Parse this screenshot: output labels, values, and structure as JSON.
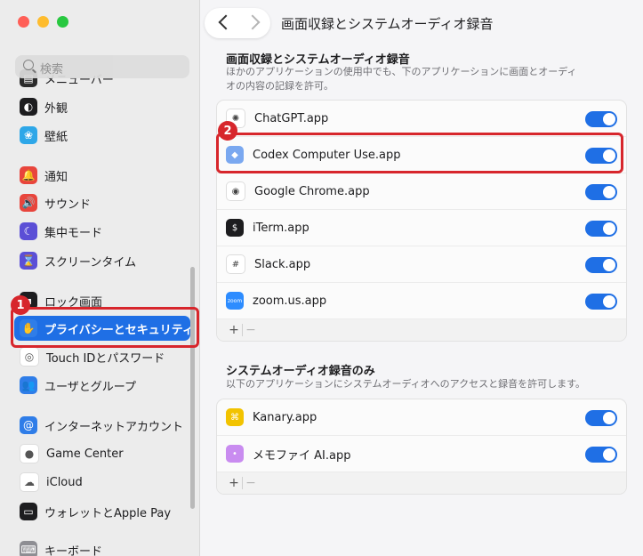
{
  "window": {
    "title": "画面収録とシステムオーディオ録音"
  },
  "sidebar": {
    "search_placeholder": "検索",
    "items": [
      {
        "label": "メニューバー",
        "icon": "menubar-icon",
        "color": "#2b2b2b",
        "glyph": "▤"
      },
      {
        "label": "外観",
        "icon": "appearance-icon",
        "color": "#1d1d1f",
        "glyph": "◐"
      },
      {
        "label": "壁紙",
        "icon": "wallpaper-icon",
        "color": "#2ea7e8",
        "glyph": "❀"
      },
      {
        "label": "通知",
        "icon": "notifications-icon",
        "color": "#e8453c",
        "glyph": "🔔"
      },
      {
        "label": "サウンド",
        "icon": "sound-icon",
        "color": "#e8453c",
        "glyph": "🔊"
      },
      {
        "label": "集中モード",
        "icon": "focus-icon",
        "color": "#5b4fd6",
        "glyph": "☾"
      },
      {
        "label": "スクリーンタイム",
        "icon": "screen-time-icon",
        "color": "#5b4fd6",
        "glyph": "⌛"
      },
      {
        "label": "ロック画面",
        "icon": "lock-screen-icon",
        "color": "#1d1d1f",
        "glyph": "▪"
      },
      {
        "label": "プライバシーとセキュリティ",
        "icon": "privacy-hand-icon",
        "color": "#2f7de8",
        "glyph": "✋"
      },
      {
        "label": "Touch IDとパスワード",
        "icon": "touch-id-icon",
        "color": "#ffffff",
        "glyph": "◎"
      },
      {
        "label": "ユーザとグループ",
        "icon": "users-icon",
        "color": "#2f7de8",
        "glyph": "👥"
      },
      {
        "label": "インターネットアカウント",
        "icon": "internet-accounts-icon",
        "color": "#2f7de8",
        "glyph": "@"
      },
      {
        "label": "Game Center",
        "icon": "game-center-icon",
        "color": "#ffffff",
        "glyph": "●"
      },
      {
        "label": "iCloud",
        "icon": "icloud-icon",
        "color": "#ffffff",
        "glyph": "☁"
      },
      {
        "label": "ウォレットとApple Pay",
        "icon": "wallet-icon",
        "color": "#1d1d1f",
        "glyph": "▭"
      },
      {
        "label": "キーボード",
        "icon": "keyboard-icon",
        "color": "#8e8e93",
        "glyph": "⌨"
      }
    ],
    "selected": "プライバシーとセキュリティ"
  },
  "main": {
    "screen_section": {
      "title": "画面収録とシステムオーディオ録音",
      "description": "ほかのアプリケーションの使用中でも、下のアプリケーションに画面とオーディオの内容の記録を許可。",
      "apps": [
        {
          "name": "ChatGPT.app",
          "icon": "chatgpt-icon",
          "color": "#ffffff",
          "glyph": "✺",
          "enabled": true
        },
        {
          "name": "Codex Computer Use.app",
          "icon": "codex-icon",
          "color": "#7aa8f0",
          "glyph": "◆",
          "enabled": true
        },
        {
          "name": "Google Chrome.app",
          "icon": "chrome-icon",
          "color": "#ffffff",
          "glyph": "◉",
          "enabled": true
        },
        {
          "name": "iTerm.app",
          "icon": "iterm-icon",
          "color": "#1d1d1f",
          "glyph": "$",
          "enabled": true
        },
        {
          "name": "Slack.app",
          "icon": "slack-icon",
          "color": "#ffffff",
          "glyph": "#",
          "enabled": true
        },
        {
          "name": "zoom.us.app",
          "icon": "zoom-icon",
          "color": "#2d8cff",
          "glyph": "zoom",
          "enabled": true
        }
      ]
    },
    "audio_section": {
      "title": "システムオーディオ録音のみ",
      "description": "以下のアプリケーションにシステムオーディオへのアクセスと録音を許可します。",
      "apps": [
        {
          "name": "Kanary.app",
          "icon": "kanary-icon",
          "color": "#f2c300",
          "glyph": "⌘",
          "enabled": true
        },
        {
          "name": "メモファイ AI.app",
          "icon": "memofy-icon",
          "color": "#c98cf0",
          "glyph": "•",
          "enabled": true
        }
      ]
    },
    "add_label": "+",
    "remove_label": "−"
  },
  "annotations": {
    "badge1": "1",
    "badge2": "2",
    "color": "#d7262c"
  },
  "accent": "#1f6fe5"
}
